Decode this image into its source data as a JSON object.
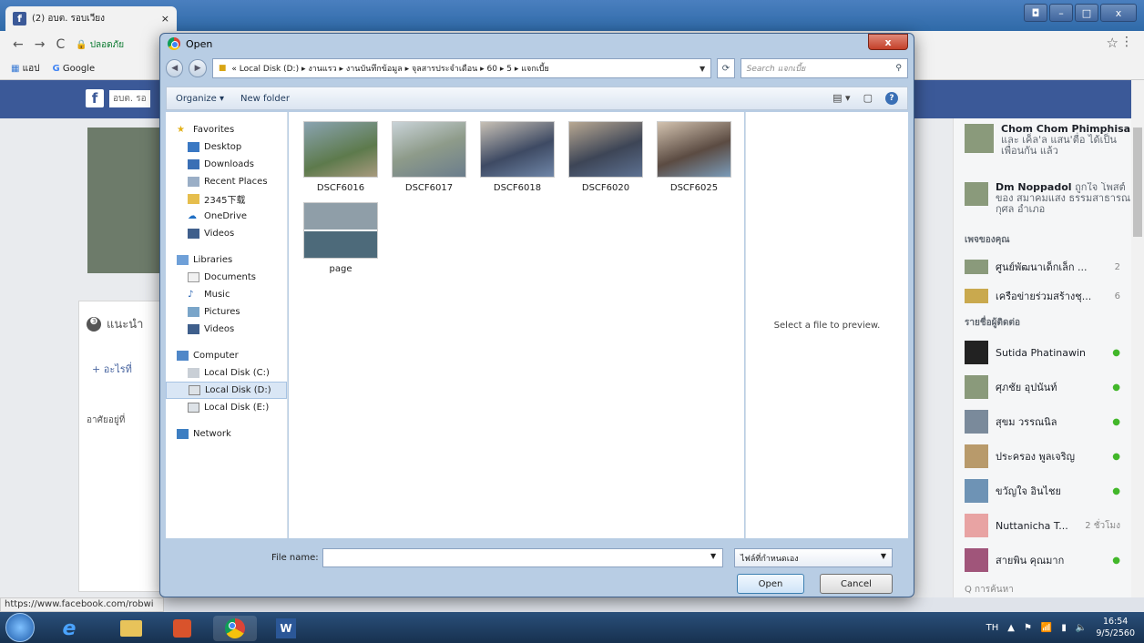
{
  "browser": {
    "tab_title": "(2) อบต. รอบเวียง",
    "tab_close": "×",
    "secure_label": "ปลอดภัย",
    "bookmarks": [
      "แอป",
      "Google"
    ],
    "status_url": "https://www.facebook.com/robwi"
  },
  "facebook": {
    "page_name": "อบต. รอ",
    "suggest_label": "แนะนำ",
    "add_label": "+ อะไรที่",
    "live_label": "อาศัยอยู่ที่",
    "right_items": [
      {
        "name": "Chom Chom Phimphisa",
        "text": "และ เค็ล'ล แสน'ตื่อ ได้เป็นเพื่อนกัน แล้ว"
      },
      {
        "name": "Dm Noppadol",
        "text": "ถูกใจ โพสต์ของ สมาคมแสง ธรรมสาธารณกุศล อำเภอ"
      }
    ],
    "pages_header": "เพจของคุณ",
    "pages": [
      {
        "name": "ศูนย์พัฒนาเด็กเล็ก ...",
        "count": "2"
      },
      {
        "name": "เครือข่ายร่วมสร้างชุ...",
        "count": "6"
      }
    ],
    "contacts_header": "รายชื่อผู้ติดต่อ",
    "contacts": [
      {
        "name": "Sutida Phatinawin",
        "status": "●"
      },
      {
        "name": "ศุภชัย อุปนันท์",
        "status": "●"
      },
      {
        "name": "สุขม วรรณนิล",
        "status": "●"
      },
      {
        "name": "ประครอง พูลเจริญ",
        "status": "●"
      },
      {
        "name": "ขวัญใจ อินไชย",
        "status": "●"
      },
      {
        "name": "Nuttanicha T...",
        "status": "2 ชั่วโมง"
      },
      {
        "name": "สายพิน คุณมาก",
        "status": "●"
      }
    ],
    "search_placeholder": "Q การค้นหา"
  },
  "dialog": {
    "title": "Open",
    "close": "x",
    "address_path": "« Local Disk (D:) ▸ งานแรว ▸ งานบันทึกข้อมูล ▸ จุลสารประจำเดือน ▸ 60 ▸ 5 ▸ แจกเบี้ย",
    "search_placeholder": "Search แจกเบี้ย",
    "organize": "Organize ▾",
    "new_folder": "New folder",
    "nav": {
      "favorites": "Favorites",
      "desktop": "Desktop",
      "downloads": "Downloads",
      "recent": "Recent Places",
      "folder2345": "2345下载",
      "onedrive": "OneDrive",
      "videos1": "Videos",
      "libraries": "Libraries",
      "documents": "Documents",
      "music": "Music",
      "pictures": "Pictures",
      "videos2": "Videos",
      "computer": "Computer",
      "disk_c": "Local Disk (C:)",
      "disk_d": "Local Disk (D:)",
      "disk_e": "Local Disk (E:)",
      "network": "Network"
    },
    "files": [
      "DSCF6016",
      "DSCF6017",
      "DSCF6018",
      "DSCF6020",
      "DSCF6025",
      "page"
    ],
    "preview_text": "Select a file to preview.",
    "file_name_label": "File name:",
    "file_name_value": "",
    "filter_value": "ไฟล์ที่กำหนดเอง",
    "open_button": "Open",
    "cancel_button": "Cancel"
  },
  "taskbar": {
    "lang": "TH",
    "time": "16:54",
    "date": "9/5/2560"
  }
}
